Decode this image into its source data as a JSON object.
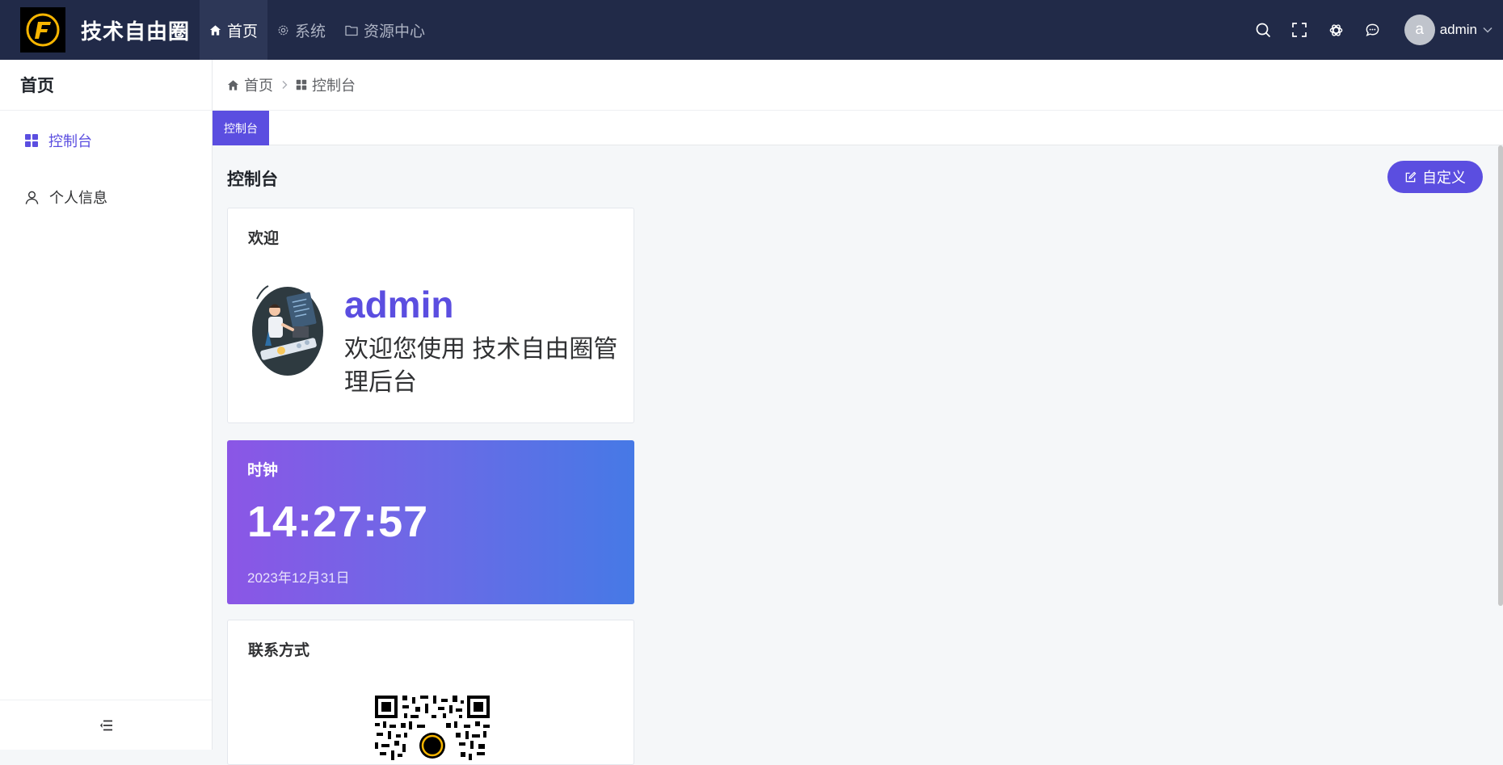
{
  "header": {
    "brand_title": "技术自由圈",
    "nav": [
      {
        "label": "首页",
        "icon": "home-icon",
        "active": true
      },
      {
        "label": "系统",
        "icon": "gear-icon",
        "active": false
      },
      {
        "label": "资源中心",
        "icon": "folder-icon",
        "active": false
      }
    ],
    "tools": [
      "search-icon",
      "fullscreen-icon",
      "openai-icon",
      "chat-icon"
    ],
    "user": {
      "avatar_letter": "a",
      "name": "admin"
    }
  },
  "sidebar": {
    "title": "首页",
    "items": [
      {
        "label": "控制台",
        "icon": "dashboard-grid-icon",
        "active": true
      },
      {
        "label": "个人信息",
        "icon": "user-icon",
        "active": false
      }
    ]
  },
  "breadcrumb": {
    "items": [
      {
        "label": "首页",
        "icon": "home-icon"
      },
      {
        "label": "控制台",
        "icon": "dashboard-grid-icon"
      }
    ]
  },
  "tabs": [
    {
      "label": "控制台",
      "active": true
    }
  ],
  "main": {
    "title": "控制台",
    "custom_button": "自定义",
    "cards": {
      "welcome": {
        "title": "欢迎",
        "name": "admin",
        "message": "欢迎您使用 技术自由圈管理后台"
      },
      "clock": {
        "title": "时钟",
        "time": "14:27:57",
        "date": "2023年12月31日"
      },
      "contact": {
        "title": "联系方式"
      }
    }
  },
  "colors": {
    "topbar": "#212a48",
    "accent": "#5b4ee0",
    "clock_gradient_start": "#8b56e6",
    "clock_gradient_end": "#4679e6"
  }
}
